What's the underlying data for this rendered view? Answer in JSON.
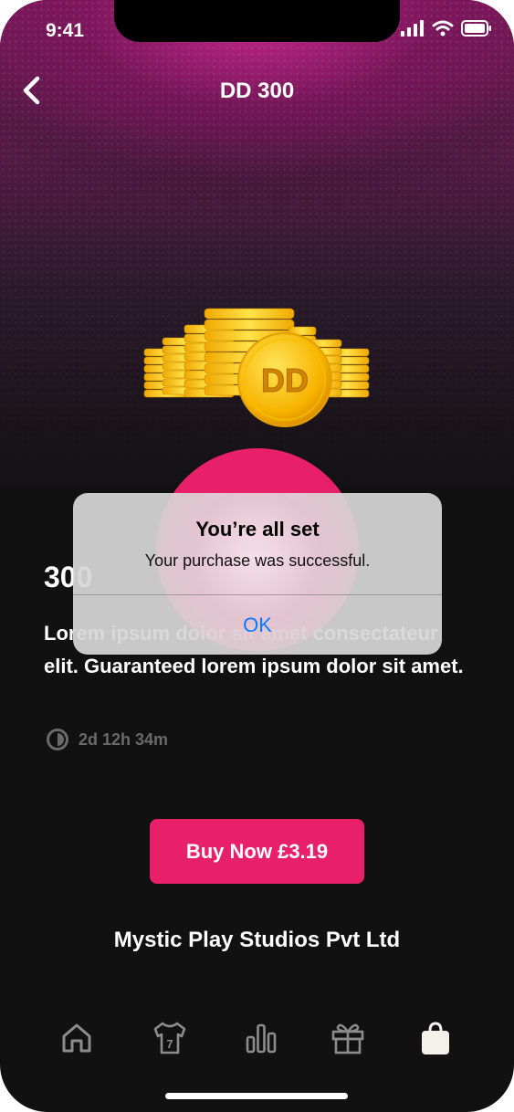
{
  "status_bar": {
    "time": "9:41"
  },
  "header": {
    "title": "DD 300"
  },
  "product": {
    "coin_label": "DD",
    "title": "300",
    "description": "Lorem ipsum dolor sit amet consectateur elit. Guaranteed lorem ipsum dolor sit amet.",
    "timer": "2d 12h 34m"
  },
  "actions": {
    "buy_label": "Buy Now £3.19"
  },
  "footer": {
    "company": "Mystic Play Studios Pvt Ltd"
  },
  "tabbar": {
    "items": [
      {
        "icon": "home-icon"
      },
      {
        "icon": "jersey-icon",
        "badge": "7"
      },
      {
        "icon": "leaderboard-icon"
      },
      {
        "icon": "gift-icon"
      },
      {
        "icon": "shop-bag-icon",
        "active": true
      }
    ]
  },
  "alert": {
    "title": "You’re all set",
    "message": "Your purchase was successful.",
    "ok_label": "OK"
  },
  "colors": {
    "accent": "#e8206a",
    "alert_button": "#0a7bff",
    "background": "#121112"
  }
}
